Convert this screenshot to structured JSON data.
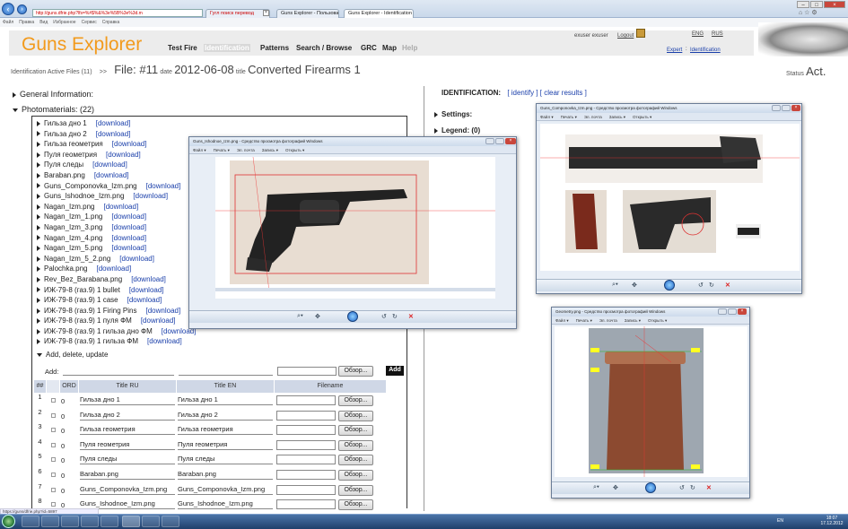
{
  "browser": {
    "address": "http://guns.dfrie.php?lfs=%#$%&%3e%5B%3e%3d.m",
    "search_tab": "Гугл поиск перевод",
    "tabs": [
      "Guns Explorer - Пользовате...",
      "Guns Explorer - Identification"
    ],
    "menu": [
      "Файл",
      "Правка",
      "Вид",
      "Избранное",
      "Сервис",
      "Справка"
    ],
    "status_url": "https://guns/dfrie.php?id=5897"
  },
  "app": {
    "logo": "Guns Explorer",
    "nav": [
      {
        "label": "Test Fire",
        "state": "normal"
      },
      {
        "label": "Identification",
        "state": "active"
      },
      {
        "label": "Patterns",
        "state": "normal"
      },
      {
        "label": "Search / Browse",
        "state": "normal"
      },
      {
        "label": "GRC",
        "state": "normal"
      },
      {
        "label": "Map",
        "state": "normal"
      },
      {
        "label": "Help",
        "state": "disabled"
      }
    ],
    "user": "exuser exuser",
    "logout": "Logout",
    "lang_eng": "ENG",
    "lang_rus": "RUS",
    "expert": "Expert",
    "crumb_sep": ":",
    "crumb": "Identification"
  },
  "fileline": {
    "active_files": "Identification Active Files (11)",
    "arrows": ">>",
    "file": "File: #11",
    "date_label": "date",
    "date": "2012-06-08",
    "title_label": "title",
    "title": "Converted Firearms 1",
    "status_label": "Status",
    "status": "Act."
  },
  "left": {
    "general": "General Information:",
    "photomaterials": "Photomaterials: (22)",
    "download": "[download]",
    "photos": [
      "Гильза дно 1",
      "Гильза дно 2",
      "Гильза геометрия",
      "Пуля геометрия",
      "Пуля следы",
      "Baraban.png",
      "Guns_Componovka_Izm.png",
      "Guns_Ishodnoe_Izm.png",
      "Nagan_Izm.png",
      "Nagan_Izm_1.png",
      "Nagan_Izm_3.png",
      "Nagan_Izm_4.png",
      "Nagan_Izm_5.png",
      "Nagan_Izm_5_2.png",
      "Palochka.png",
      "Rev_Bez_Barabana.png",
      "ИЖ-79-8 (газ.9) 1 bullet",
      "ИЖ-79-8 (газ.9) 1 case",
      "ИЖ-79-8 (газ.9) 1 Firing Pins",
      "ИЖ-79-8 (газ.9) 1 пуля ФМ",
      "ИЖ-79-8 (газ.9) 1 гильза дно ФМ",
      "ИЖ-79-8 (газ.9) 1 гильза ФМ"
    ],
    "add_delete": "Add, delete, update",
    "add_label": "Add:",
    "browse": "Обзор...",
    "add_btn": "Add",
    "table_headers": [
      "##",
      "ORD",
      "Title RU",
      "Title EN",
      "Filename"
    ],
    "rows": [
      {
        "n": "1",
        "ord": "0",
        "ru": "Гильза дно 1",
        "en": "Гильза дно 1"
      },
      {
        "n": "2",
        "ord": "0",
        "ru": "Гильза дно 2",
        "en": "Гильза дно 2"
      },
      {
        "n": "3",
        "ord": "0",
        "ru": "Гильза геометрия",
        "en": "Гильза геометрия"
      },
      {
        "n": "4",
        "ord": "0",
        "ru": "Пуля геометрия",
        "en": "Пуля геометрия"
      },
      {
        "n": "5",
        "ord": "0",
        "ru": "Пуля следы",
        "en": "Пуля следы"
      },
      {
        "n": "6",
        "ord": "0",
        "ru": "Baraban.png",
        "en": "Baraban.png"
      },
      {
        "n": "7",
        "ord": "0",
        "ru": "Guns_Componovka_Izm.png",
        "en": "Guns_Componovka_Izm.png"
      },
      {
        "n": "8",
        "ord": "0",
        "ru": "Guns_Ishodnoe_Izm.png",
        "en": "Guns_Ishodnoe_Izm.png"
      }
    ]
  },
  "right": {
    "identification": "IDENTIFICATION:",
    "identify": "[ identify ]",
    "clear": "[ clear results ]",
    "settings": "Settings:",
    "legend": "Legend: (0)"
  },
  "viewers": {
    "w1_title": "Guns_Ishodnoe_Izm.png - Средство просмотра фотографий Windows",
    "w2_title": "Guns_Componovka_Izm.png - Средство просмотра фотографий Windows",
    "w3_title": "Geometry.png - Средство просмотра фотографий Windows",
    "menu": [
      "Файл ▾",
      "Печать ▾",
      "Эл. почта",
      "Запись ▾",
      "Открыть ▾"
    ]
  },
  "taskbar": {
    "lang": "EN",
    "time": "18:07",
    "date": "17.12.2012"
  },
  "colors": {
    "logo": "#f29a1c",
    "link": "#1a3faa",
    "taskbar": "#2a4f82"
  }
}
